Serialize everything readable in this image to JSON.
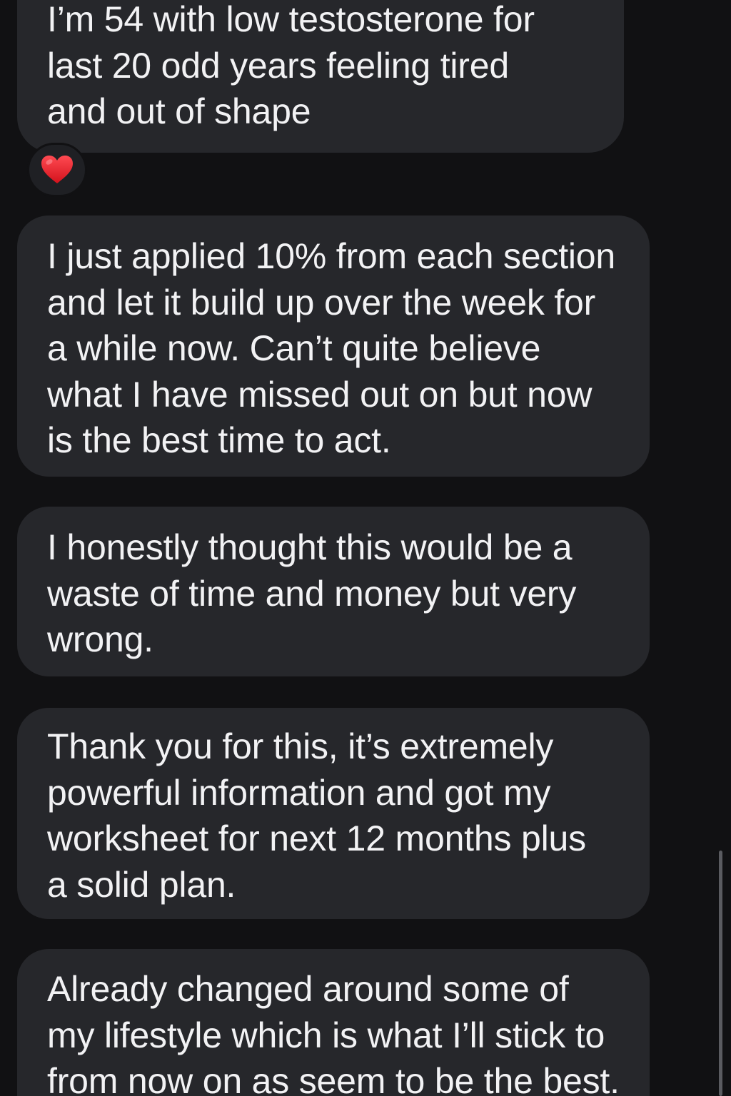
{
  "messages": [
    {
      "text": "I’m 54 with low testosterone for\nlast 20 odd years feeling tired\nand out of shape",
      "reaction": "heart-icon"
    },
    {
      "text": "I just applied 10% from each section\nand let it build up over the week for\na while now. Can’t quite believe\nwhat I have missed out on but now\nis the best time to act."
    },
    {
      "text": "I honestly thought this would be a\nwaste of time and money but very\nwrong."
    },
    {
      "text": "Thank you for this, it’s extremely\npowerful information and got my\nworksheet for next 12 months plus\na solid plan."
    },
    {
      "text": "Already changed around some of\nmy lifestyle which is what I’ll stick to\nfrom now on as seem to be the best."
    }
  ],
  "colors": {
    "background": "#111113",
    "bubble": "#26272b",
    "text": "#f2f2f4",
    "reaction_heart": "#e8202b"
  }
}
